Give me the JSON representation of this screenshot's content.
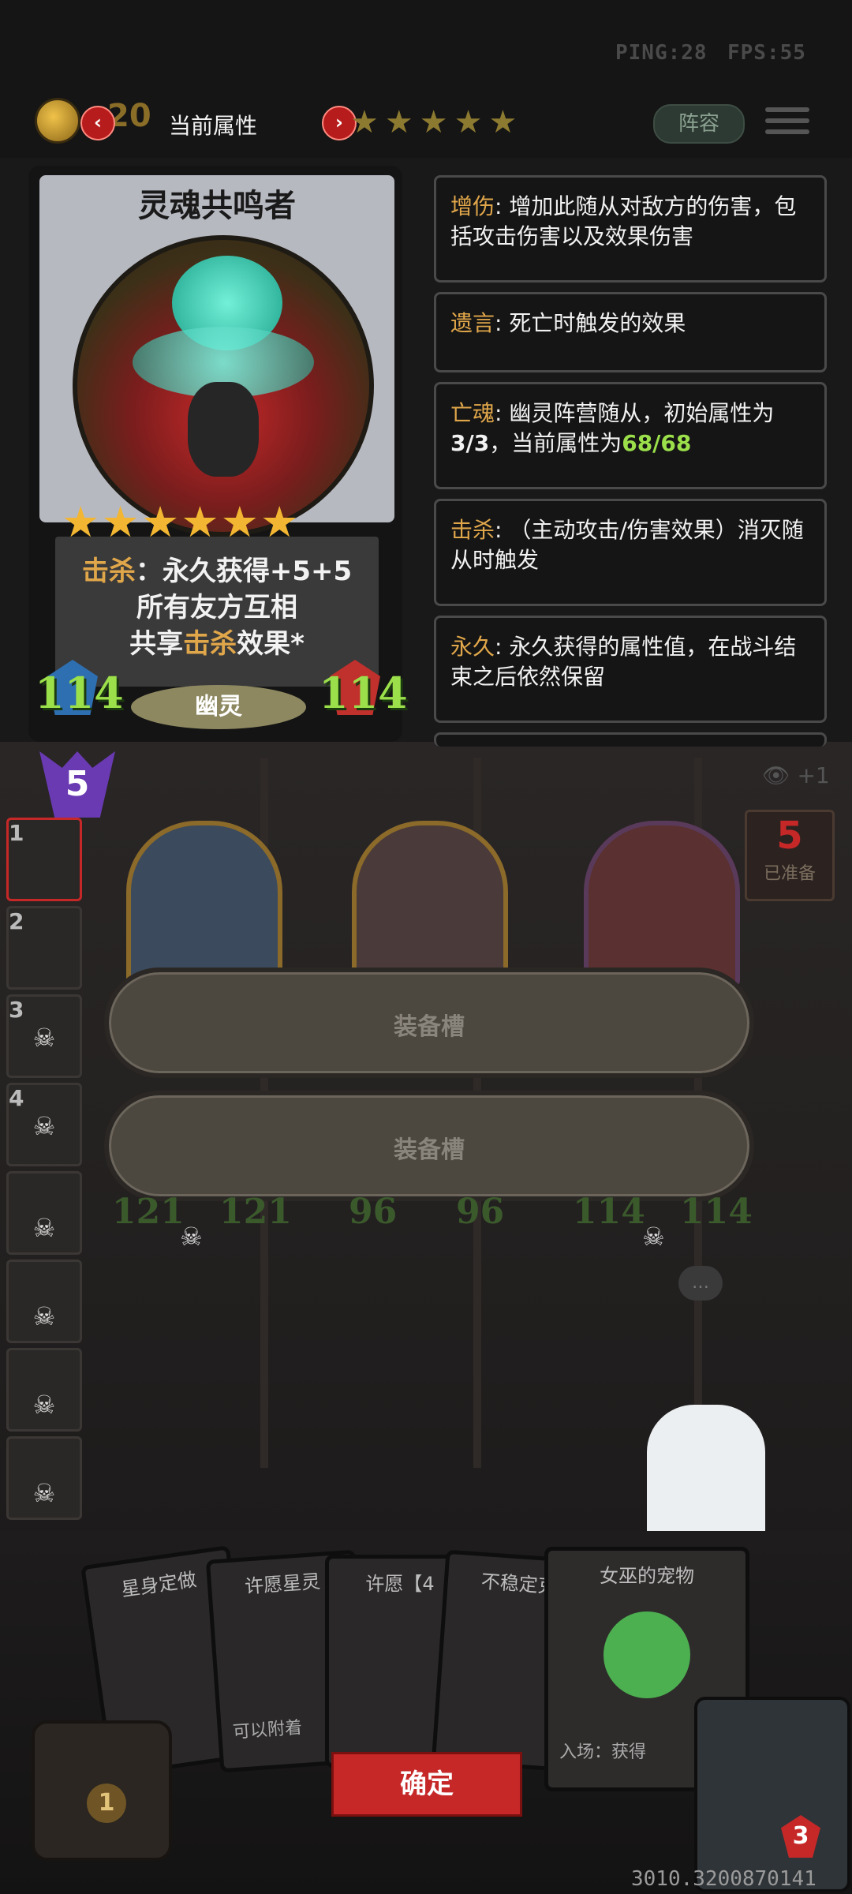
{
  "hud": {
    "ping": "PING:28",
    "fps": "FPS:55",
    "gold": "20",
    "attr_title": "当前属性",
    "prev_icon": "‹",
    "next_icon": "›",
    "tavern_stars": "★★★★★",
    "lineup_label": "阵容"
  },
  "card": {
    "name": "灵魂共鸣者",
    "stars": "★★★★★★",
    "text_line1_kw": "击杀",
    "text_line1_rest": "：永久获得+5+5",
    "text_line2": "所有友方互相",
    "text_line3_pre": "共享",
    "text_line3_kw": "击杀",
    "text_line3_post": "效果*",
    "attack": "114",
    "health": "114",
    "tribe": "幽灵"
  },
  "keywords": [
    {
      "term": "增伤",
      "desc": ": 增加此随从对敌方的伤害，包括攻击伤害以及效果伤害"
    },
    {
      "term": "遗言",
      "desc": ": 死亡时触发的效果"
    },
    {
      "term": "亡魂",
      "desc_pre": ": 幽灵阵营随从，初始属性为",
      "desc_num1": "3/3",
      "desc_mid": "，当前属性为",
      "desc_num2": "68/68"
    },
    {
      "term": "击杀",
      "desc": ": （主动攻击/伤害效果）消灭随从时触发"
    },
    {
      "term": "永久",
      "desc": ": 永久获得的属性值，在战斗结束之后依然保留"
    }
  ],
  "board": {
    "tier": "5",
    "side_slots": [
      "1",
      "2",
      "3",
      "4"
    ],
    "equip_slot_label": "装备槽",
    "minion_stats": [
      {
        "attack": "121",
        "health": "121"
      },
      {
        "attack": "96",
        "health": "96"
      },
      {
        "attack": "114",
        "health": "114"
      }
    ],
    "ready_count": "5",
    "ready_label": "已准备",
    "eye_plus": "+1"
  },
  "hand": {
    "cards": [
      "星身定做",
      "许愿星灵",
      "许愿【4",
      "不稳定克",
      "女巫的宠物"
    ],
    "hand_text_1": "可以附着",
    "hand_text_2": "入场：获得",
    "confirm_label": "确定",
    "bag_count": "1",
    "hero_hp": "3"
  },
  "footer_id": "3010.3200870141",
  "colors": {
    "keyword": "#e0a64a",
    "stat_green": "#9be04a",
    "confirm_red": "#c62828",
    "tier_purple": "#6a3ab3"
  }
}
